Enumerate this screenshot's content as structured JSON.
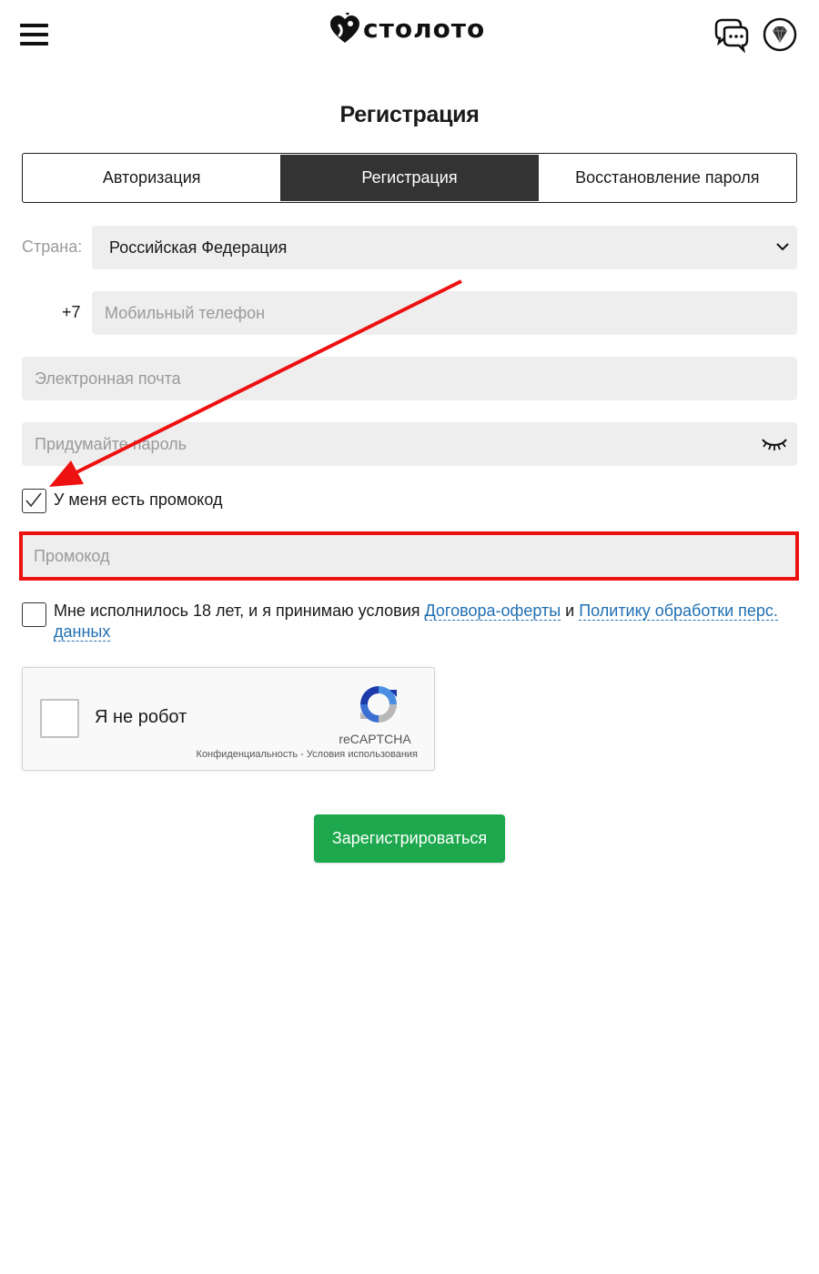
{
  "header": {
    "logo_text": "столото",
    "logo_icon": "heart-logo-icon",
    "menu_icon": "hamburger-menu-icon",
    "chat_icon": "chat-support-icon",
    "profile_icon": "diamond-icon"
  },
  "page": {
    "title": "Регистрация"
  },
  "tabs": [
    {
      "label": "Авторизация",
      "active": false
    },
    {
      "label": "Регистрация",
      "active": true
    },
    {
      "label": "Восстановление пароля",
      "active": false
    }
  ],
  "form": {
    "country_label": "Страна:",
    "country_value": "Российская Федерация",
    "phone_prefix": "+7",
    "phone_placeholder": "Мобильный телефон",
    "email_placeholder": "Электронная почта",
    "password_placeholder": "Придумайте пароль",
    "promo_checkbox_label": "У меня есть промокод",
    "promo_checked": true,
    "promo_placeholder": "Промокод",
    "terms_checked": false,
    "terms_text_before": "Мне исполнилось 18 лет, и я принимаю условия ",
    "terms_link_offer": "Договора-оферты",
    "terms_text_and": " и ",
    "terms_link_policy": "Политику обработки перс. данных",
    "submit_label": "Зарегистрироваться"
  },
  "recaptcha": {
    "label": "Я не робот",
    "brand": "reCAPTCHA",
    "privacy": "Конфиденциальность",
    "separator": " - ",
    "terms": "Условия использования"
  },
  "colors": {
    "accent_green": "#1ea84d",
    "active_tab": "#333333",
    "link_blue": "#1f6fb2",
    "annotation_red": "#ee1111",
    "field_bg": "#eeeeee"
  }
}
